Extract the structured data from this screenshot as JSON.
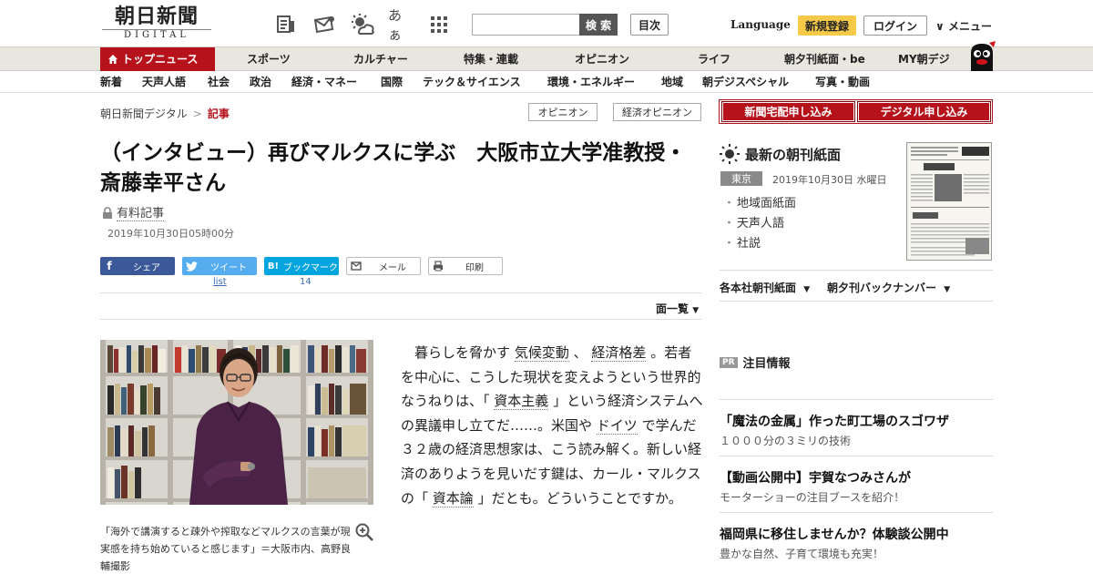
{
  "header": {
    "logo_main": "朝日新聞",
    "logo_sub": "DIGITAL",
    "kana_icon": "あぁ",
    "search_placeholder": "",
    "search_label": "検 索",
    "toc_label": "目次",
    "language_label": "Language",
    "register_label": "新規登録",
    "login_label": "ログイン",
    "menu_label": "メニュー"
  },
  "nav_primary": [
    "トップニュース",
    "スポーツ",
    "カルチャー",
    "特集・連載",
    "オピニオン",
    "ライフ",
    "朝夕刊紙面・be",
    "MY朝デジ"
  ],
  "nav_secondary": [
    "新着",
    "天声人語",
    "社会",
    "政治",
    "経済・マネー",
    "国際",
    "テック＆サイエンス",
    "環境・エネルギー",
    "地域",
    "朝デジスペシャル",
    "写真・動画"
  ],
  "breadcrumb": {
    "home": "朝日新聞デジタル",
    "separator": ">",
    "current": "記事"
  },
  "tags": [
    "オピニオン",
    "経済オピニオン"
  ],
  "article": {
    "headline": "（インタビュー）再びマルクスに学ぶ　大阪市立大学准教授・斎藤幸平さん",
    "paid_label": "有料記事",
    "date": "2019年10月30日05時00分",
    "share": {
      "facebook": "シェア",
      "twitter": "ツイート",
      "twitter_count": "list",
      "hatena_icon": "B!",
      "hatena": "ブックマーク",
      "hatena_count": "14",
      "mail": "メール",
      "print": "印刷"
    },
    "paper_list_label": "面一覧",
    "caption": "「海外で講演すると疎外や搾取などマルクスの言葉が現実感を持ち始めていると感じます」＝大阪市内、高野良輔撮影",
    "body": {
      "p1": "暮らしを脅かす",
      "kw1": "気候変動",
      "p2": "、",
      "kw2": "経済格差",
      "p3": "。若者を中心に、こうした現状を変えようという世界的なうねりは、「",
      "kw3": "資本主義",
      "p4": "」という経済システムへの異議申し立てだ……。米国や",
      "kw4": "ドイツ",
      "p5": "で学んだ３２歳の経済思想家は、こう読み解く。新しい経済のありようを見いだす鍵は、カール・マルクスの「",
      "kw5": "資本論",
      "p6": "」だとも。どういうことですか。"
    }
  },
  "sidebar": {
    "home_delivery": "新聞宅配申し込み",
    "digital_signup": "デジタル申し込み",
    "morning_paper_title": "最新の朝刊紙面",
    "region": "東京",
    "paper_date": "2019年10月30日 水曜日",
    "paper_links": [
      "地域面紙面",
      "天声人語",
      "社説"
    ],
    "dropdown1": "各本社朝刊紙面",
    "dropdown2": "朝夕刊バックナンバー",
    "pr_badge": "PR",
    "pr_heading": "注目情報",
    "promos": [
      {
        "title": "「魔法の金属」作った町工場のスゴワザ",
        "sub": "１０００分の３ミリの技術"
      },
      {
        "title": "【動画公開中】宇賀なつみさんが",
        "sub": "モーターショーの注目ブースを紹介！"
      },
      {
        "title": "福岡県に移住しませんか？体験談公開中",
        "sub": "豊かな自然、子育て環境も充実！"
      }
    ]
  },
  "colors": {
    "brand_red": "#b5121b",
    "register_yellow": "#f7c948",
    "nav_bg": "#e8e6df",
    "facebook": "#3b5998",
    "twitter": "#55acee",
    "hatena": "#00a4de"
  }
}
